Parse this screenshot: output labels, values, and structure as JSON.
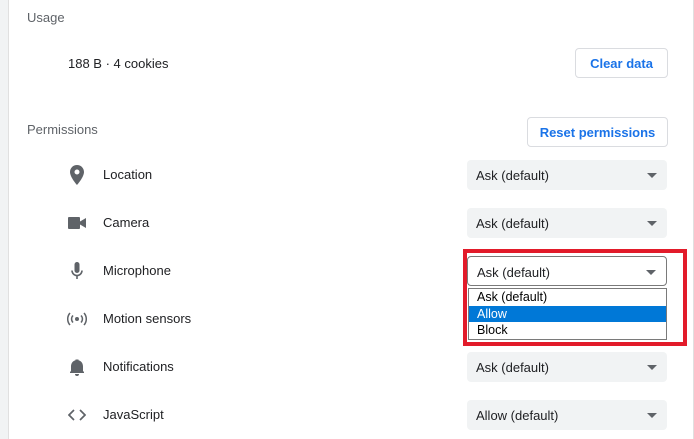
{
  "usage": {
    "title": "Usage",
    "value": "188 B · 4 cookies",
    "clear_button": "Clear data"
  },
  "permissions": {
    "title": "Permissions",
    "reset_button": "Reset permissions",
    "rows": [
      {
        "label": "Location",
        "value": "Ask (default)",
        "icon": "location-pin-icon"
      },
      {
        "label": "Camera",
        "value": "Ask (default)",
        "icon": "camera-icon"
      },
      {
        "label": "Microphone",
        "value": "Ask (default)",
        "icon": "microphone-icon"
      },
      {
        "label": "Motion sensors",
        "value": "",
        "icon": "motion-sensors-icon"
      },
      {
        "label": "Notifications",
        "value": "Ask (default)",
        "icon": "bell-icon"
      },
      {
        "label": "JavaScript",
        "value": "Allow (default)",
        "icon": "code-brackets-icon"
      }
    ]
  },
  "microphone_dropdown": {
    "options": [
      "Ask (default)",
      "Allow",
      "Block"
    ],
    "highlighted": "Allow"
  },
  "colors": {
    "accent": "#1a73e8",
    "highlight_border": "#e21b2a",
    "option_selected": "#0078d7"
  }
}
